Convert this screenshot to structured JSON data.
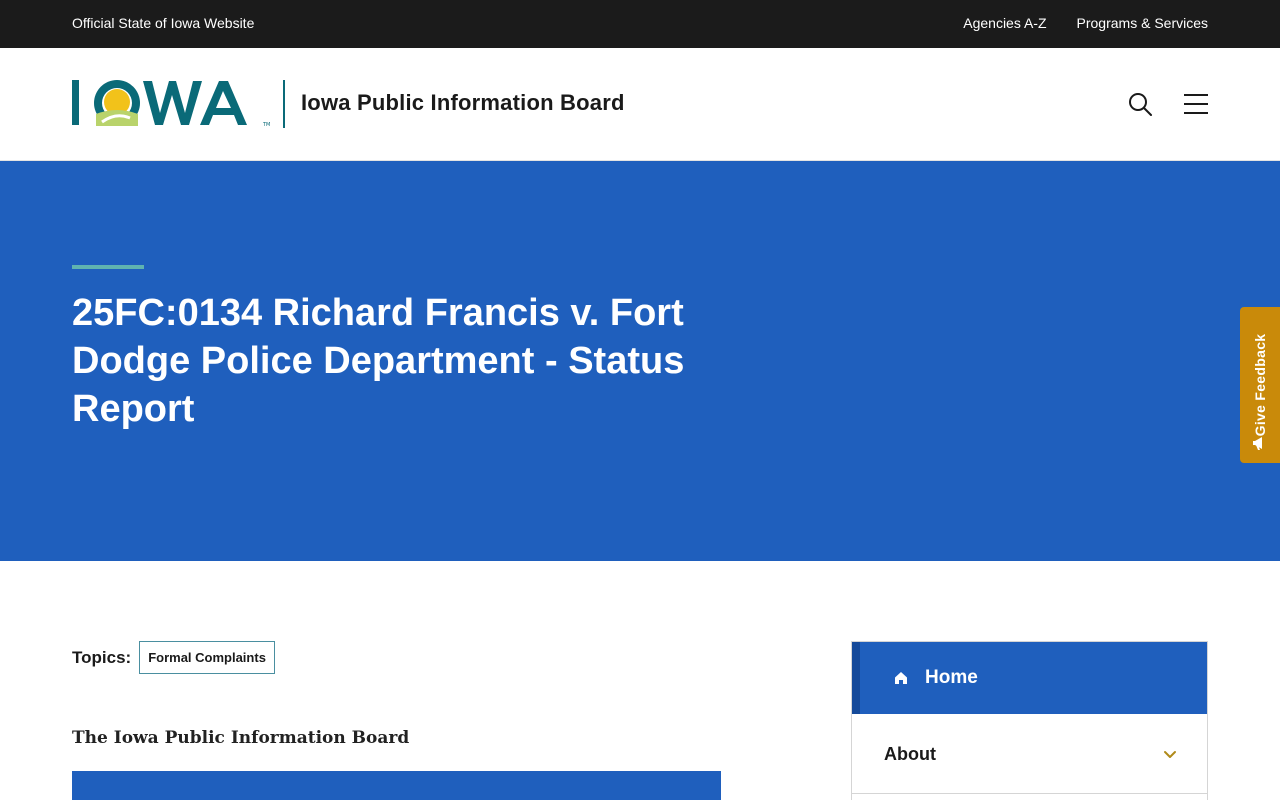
{
  "utility_bar": {
    "official_text": "Official State of Iowa Website",
    "links": [
      "Agencies A-Z",
      "Programs & Services"
    ]
  },
  "header": {
    "logo_text": "IOWA",
    "site_name": "Iowa Public Information Board",
    "search_icon": "search-icon",
    "menu_icon": "hamburger-menu-icon"
  },
  "hero": {
    "title": "25FC:0134 Richard Francis v. Fort Dodge Police Department - Status Report"
  },
  "feedback": {
    "label": "Give Feedback",
    "icon": "megaphone-icon"
  },
  "content": {
    "topics_label": "Topics:",
    "topics": [
      "Formal Complaints"
    ],
    "org_heading": "The Iowa Public Information Board"
  },
  "side_nav": {
    "items": [
      {
        "label": "Home",
        "icon": "home-icon",
        "active": true
      },
      {
        "label": "About",
        "icon": "chevron-down-icon",
        "active": false
      }
    ]
  },
  "colors": {
    "utility_bg": "#1b1b1b",
    "hero_bg": "#1f5fbd",
    "accent_teal": "#5fb3b0",
    "feedback_bg": "#c98a0a",
    "logo_teal": "#0a6a78",
    "logo_yellow": "#f2c21a",
    "logo_green": "#b9d36b"
  }
}
